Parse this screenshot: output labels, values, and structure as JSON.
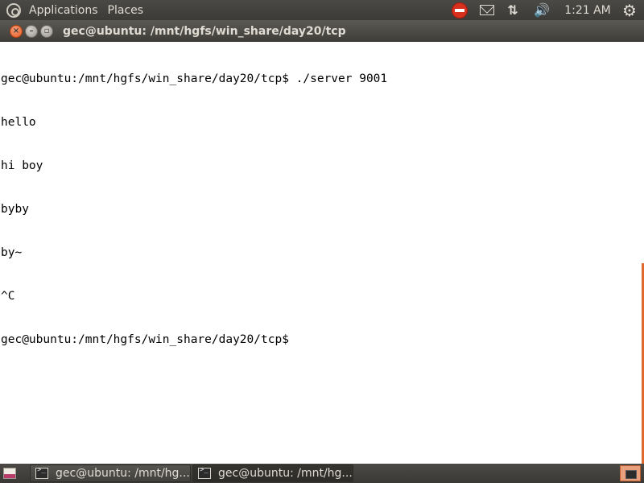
{
  "top_panel": {
    "menus": [
      "Applications",
      "Places"
    ],
    "clock": "1:21 AM",
    "icons": {
      "logo": "ubuntu-logo-icon",
      "stop": "stop-icon",
      "mail": "mail-icon",
      "network": "network-icon",
      "volume": "volume-icon",
      "session": "power-icon"
    },
    "network_glyph": "⇅",
    "volume_glyph": "🔊",
    "session_glyph": "⚙"
  },
  "window": {
    "title": "gec@ubuntu: /mnt/hgfs/win_share/day20/tcp",
    "close_glyph": "×",
    "minimize_glyph": "–",
    "maximize_glyph": "▫"
  },
  "terminal": {
    "lines": [
      "gec@ubuntu:/mnt/hgfs/win_share/day20/tcp$ ./server 9001",
      "hello",
      "hi boy",
      "byby",
      "by~",
      "^C",
      "gec@ubuntu:/mnt/hgfs/win_share/day20/tcp$ "
    ]
  },
  "taskbar": {
    "tasks": [
      {
        "label": "gec@ubuntu: /mnt/hg...",
        "active": false
      },
      {
        "label": "gec@ubuntu: /mnt/hg...",
        "active": true
      }
    ]
  },
  "colors": {
    "panel": "#3c3b37",
    "panel_text": "#dfdbd2",
    "accent_orange": "#e06a2d",
    "close_button": "#e25920",
    "terminal_bg": "#ffffff",
    "terminal_fg": "#000000"
  }
}
